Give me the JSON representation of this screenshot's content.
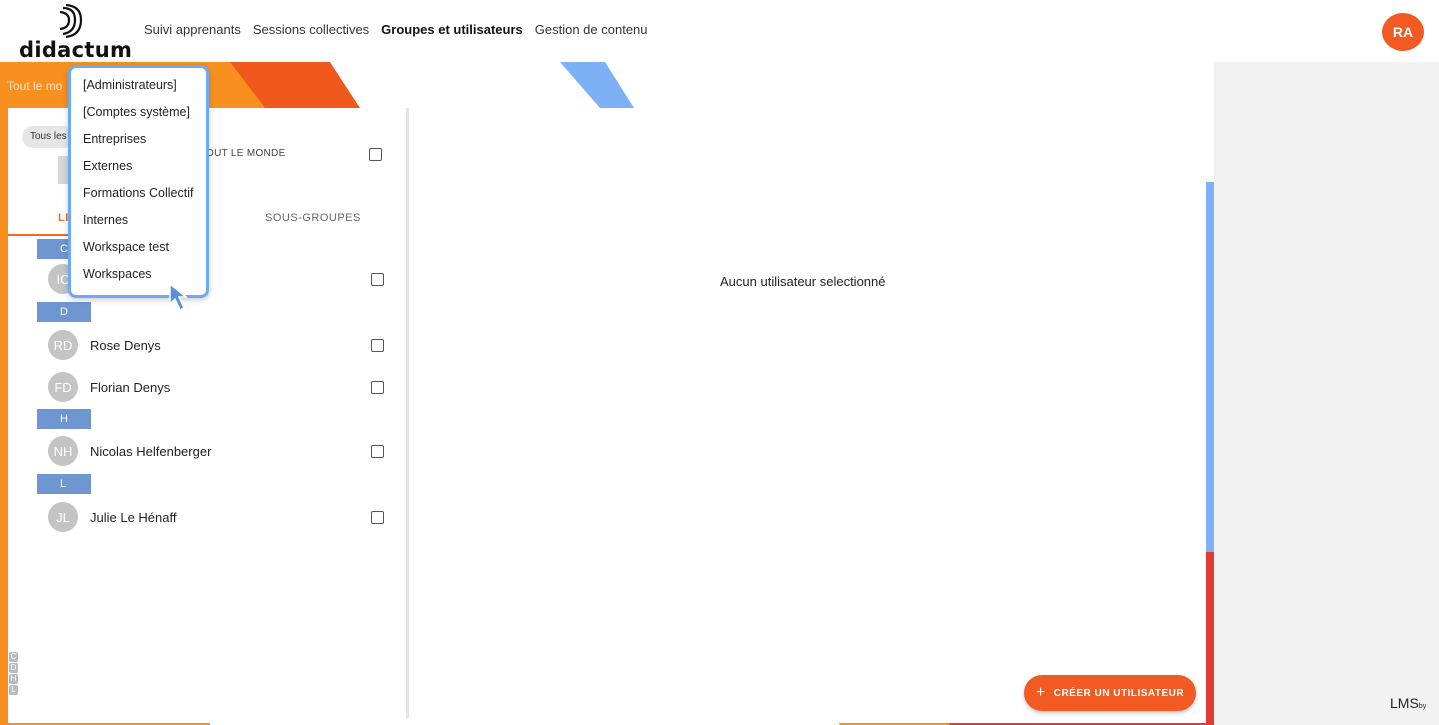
{
  "brand": {
    "name": "didactum"
  },
  "nav": {
    "items": [
      "Suivi apprenants",
      "Sessions collectives",
      "Groupes et utilisateurs",
      "Gestion de contenu"
    ],
    "active_index": 2
  },
  "user": {
    "initials": "RA"
  },
  "breadcrumb": {
    "label": "Tout le mo"
  },
  "filter": {
    "chip": "Tous les"
  },
  "group_row": {
    "label": "OUT LE MONDE"
  },
  "tabs": {
    "users": "LI",
    "subgroups": "SOUS-GROUPES"
  },
  "groups": [
    {
      "letter": "C",
      "users": [
        {
          "initials": "IC",
          "name": ""
        }
      ]
    },
    {
      "letter": "D",
      "users": [
        {
          "initials": "RD",
          "name": "Rose Denys"
        },
        {
          "initials": "FD",
          "name": "Florian Denys"
        }
      ]
    },
    {
      "letter": "H",
      "users": [
        {
          "initials": "NH",
          "name": "Nicolas Helfenberger"
        }
      ]
    },
    {
      "letter": "L",
      "users": [
        {
          "initials": "JL",
          "name": "Julie Le Hénaff"
        }
      ]
    }
  ],
  "detail": {
    "empty_message": "Aucun utilisateur selectionné"
  },
  "alpha_index": [
    "C",
    "D",
    "H",
    "L"
  ],
  "create_button": {
    "icon": "+",
    "label": "CRÉER UN UTILISATEUR"
  },
  "dropdown": {
    "options": [
      "[Administrateurs]",
      "[Comptes système]",
      "Entreprises",
      "Externes",
      "Formations Collectif",
      "Internes",
      "Workspace test",
      "Workspaces"
    ]
  },
  "footer": {
    "lms": "LMS",
    "by": "by"
  },
  "colors": {
    "accent": "#f15a22",
    "blue": "#6f96d1",
    "frame_blue": "#7eb0f5",
    "red": "#e53935"
  }
}
